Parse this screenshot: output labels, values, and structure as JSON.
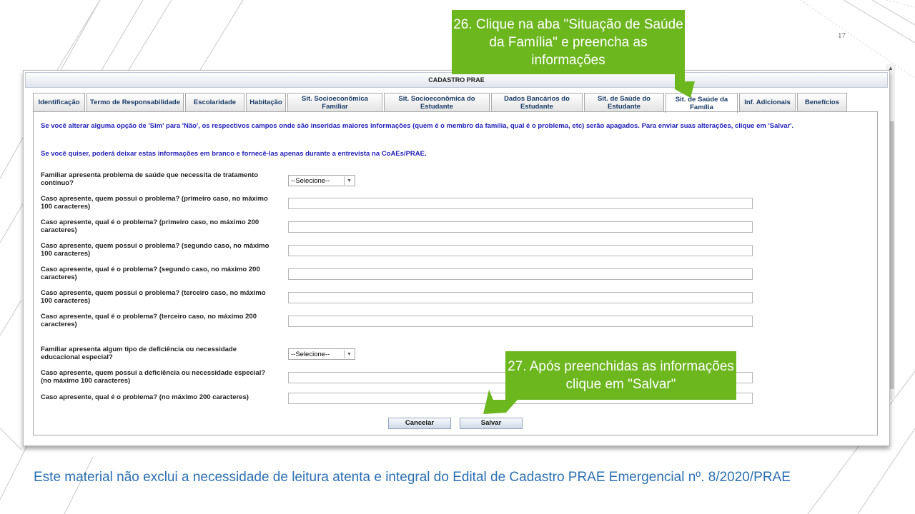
{
  "slide": {
    "number": "17",
    "footer_note": "Este material não exclui a necessidade de leitura atenta e integral do Edital de Cadastro PRAE Emergencial nº. 8/2020/PRAE"
  },
  "window": {
    "title": "CADASTRO PRAE"
  },
  "tabs": [
    {
      "label": "Identificação"
    },
    {
      "label": "Termo de Responsabilidade"
    },
    {
      "label": "Escolaridade"
    },
    {
      "label": "Habitação"
    },
    {
      "label": "Sit. Socioeconômica Familiar"
    },
    {
      "label": "Sit. Socioeconômica do Estudante"
    },
    {
      "label": "Dados Bancários do Estudante"
    },
    {
      "label": "Sit. de Saúde do Estudante"
    },
    {
      "label": "Sit. de Saúde da Família",
      "active": true
    },
    {
      "label": "Inf. Adicionais"
    },
    {
      "label": "Benefícios"
    }
  ],
  "messages": {
    "warning": "Se você alterar alguma opção de 'Sim' para 'Não', os respectivos campos onde são inseridas maiores informações (quem é o membro da família, qual é o problema, etc) serão apagados. Para enviar suas alterações, clique em 'Salvar'.",
    "optional": "Se você quiser, poderá deixar estas informações em branco e fornecê-las apenas durante a entrevista na CoAEs/PRAE."
  },
  "form": {
    "health_question": "Familiar apresenta problema de saúde que necessita de tratamento contínuo?",
    "health_select_value": "--Selecione--",
    "fields": [
      {
        "label": "Caso apresente, quem possui o problema? (primeiro caso, no máximo 100 caracteres)",
        "value": ""
      },
      {
        "label": "Caso apresente, qual é o problema? (primeiro caso, no máximo 200 caracteres)",
        "value": ""
      },
      {
        "label": "Caso apresente, quem possui o problema? (segundo caso, no máximo 100 caracteres)",
        "value": ""
      },
      {
        "label": "Caso apresente, qual é o problema? (segundo caso, no máximo 200 caracteres)",
        "value": ""
      },
      {
        "label": "Caso apresente, quem possui o problema? (terceiro caso, no máximo 100 caracteres)",
        "value": ""
      },
      {
        "label": "Caso apresente, qual é o problema? (terceiro caso, no máximo 200 caracteres)",
        "value": ""
      }
    ],
    "disability_question": "Familiar apresenta algum tipo de deficiência ou necessidade educacional especial?",
    "disability_select_value": "--Selecione--",
    "disability_fields": [
      {
        "label": "Caso apresente, quem possui a deficiência ou necessidade especial? (no máximo 100 caracteres)",
        "value": ""
      },
      {
        "label": "Caso apresente, qual é o problema? (no máximo 200 caracteres)",
        "value": ""
      }
    ]
  },
  "buttons": {
    "cancel": "Cancelar",
    "save": "Salvar"
  },
  "callouts": {
    "step26": "26. Clique na aba \"Situação de Saúde da Família\" e preencha as informações",
    "step27": "27. Após preenchidas as informações clique em \"Salvar\""
  },
  "colors": {
    "callout_green": "#6cb61e",
    "message_blue": "#1f1fb8",
    "footer_blue": "#2b6fb2"
  },
  "icons": {
    "scroll_up": "chevron-up-icon",
    "select_arrow": "chevron-down-icon"
  }
}
